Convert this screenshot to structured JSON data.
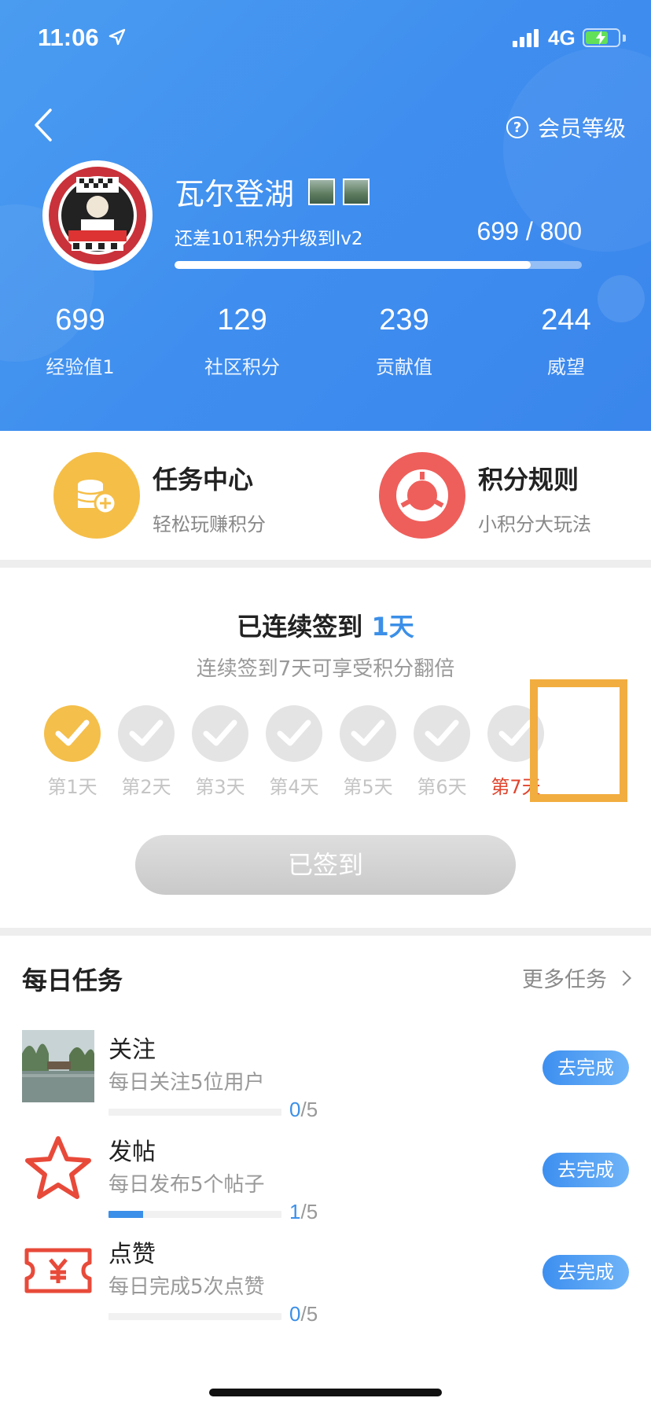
{
  "status_bar": {
    "time": "11:06",
    "network": "4G"
  },
  "header": {
    "level_link": "会员等级",
    "username": "瓦尔登湖",
    "upgrade_tip": "还差101积分升级到lv2",
    "progress_text": "699 / 800",
    "progress": {
      "current": 699,
      "max": 800
    },
    "stats": [
      {
        "value": "699",
        "label": "经验值1"
      },
      {
        "value": "129",
        "label": "社区积分"
      },
      {
        "value": "239",
        "label": "贡献值"
      },
      {
        "value": "244",
        "label": "威望"
      }
    ]
  },
  "entries": [
    {
      "title": "任务中心",
      "subtitle": "轻松玩赚积分",
      "color": "#f5be47"
    },
    {
      "title": "积分规则",
      "subtitle": "小积分大玩法",
      "color": "#ee5f5b"
    }
  ],
  "signin": {
    "title_prefix": "已连续签到 ",
    "title_days": "1天",
    "subtitle": "连续签到7天可享受积分翻倍",
    "days": [
      {
        "label": "第1天",
        "done": true
      },
      {
        "label": "第2天",
        "done": false
      },
      {
        "label": "第3天",
        "done": false
      },
      {
        "label": "第4天",
        "done": false
      },
      {
        "label": "第5天",
        "done": false
      },
      {
        "label": "第6天",
        "done": false
      },
      {
        "label": "第7天",
        "done": false,
        "highlight": true
      }
    ],
    "button_label": "已签到"
  },
  "tasks": {
    "title": "每日任务",
    "more_label": "更多任务",
    "items": [
      {
        "name": "关注",
        "desc": "每日关注5位用户",
        "current": "0",
        "total": "/5",
        "progress": 0,
        "button": "去完成",
        "icon": "lake-photo"
      },
      {
        "name": "发帖",
        "desc": "每日发布5个帖子",
        "current": "1",
        "total": "/5",
        "progress": 0.2,
        "button": "去完成",
        "icon": "star-icon"
      },
      {
        "name": "点赞",
        "desc": "每日完成5次点赞",
        "current": "0",
        "total": "/5",
        "progress": 0,
        "button": "去完成",
        "icon": "yuan-ticket-icon"
      }
    ]
  },
  "colors": {
    "primary": "#3b8fe8",
    "accent_orange": "#f2ad40",
    "accent_red": "#e0442e"
  }
}
